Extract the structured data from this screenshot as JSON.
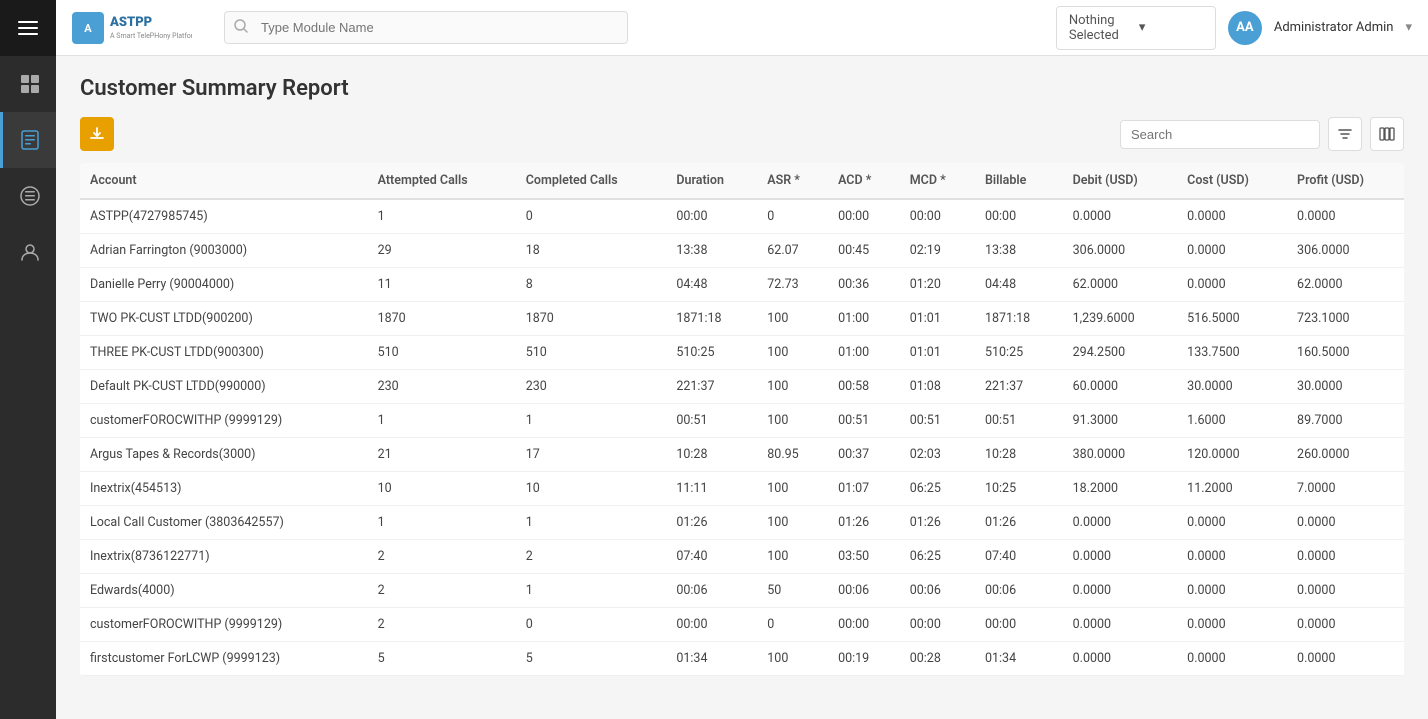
{
  "app": {
    "name": "ASTPP",
    "tagline": "A Smart TelePHony Platform"
  },
  "topbar": {
    "search_placeholder": "Type Module Name",
    "nothing_selected": "Nothing Selected",
    "user_initials": "AA",
    "user_name": "Administrator Admin"
  },
  "page": {
    "title": "Customer Summary Report"
  },
  "toolbar": {
    "search_placeholder": "Search"
  },
  "table": {
    "headers": [
      "Account",
      "Attempted Calls",
      "Completed Calls",
      "Duration",
      "ASR *",
      "ACD *",
      "MCD *",
      "Billable",
      "Debit (USD)",
      "Cost (USD)",
      "Profit (USD)"
    ],
    "rows": [
      [
        "ASTPP(4727985745)",
        "1",
        "0",
        "00:00",
        "0",
        "00:00",
        "00:00",
        "00:00",
        "0.0000",
        "0.0000",
        "0.0000"
      ],
      [
        "Adrian Farrington (9003000)",
        "29",
        "18",
        "13:38",
        "62.07",
        "00:45",
        "02:19",
        "13:38",
        "306.0000",
        "0.0000",
        "306.0000"
      ],
      [
        "Danielle Perry (90004000)",
        "11",
        "8",
        "04:48",
        "72.73",
        "00:36",
        "01:20",
        "04:48",
        "62.0000",
        "0.0000",
        "62.0000"
      ],
      [
        "TWO PK-CUST LTDD(900200)",
        "1870",
        "1870",
        "1871:18",
        "100",
        "01:00",
        "01:01",
        "1871:18",
        "1,239.6000",
        "516.5000",
        "723.1000"
      ],
      [
        "THREE PK-CUST LTDD(900300)",
        "510",
        "510",
        "510:25",
        "100",
        "01:00",
        "01:01",
        "510:25",
        "294.2500",
        "133.7500",
        "160.5000"
      ],
      [
        "Default PK-CUST LTDD(990000)",
        "230",
        "230",
        "221:37",
        "100",
        "00:58",
        "01:08",
        "221:37",
        "60.0000",
        "30.0000",
        "30.0000"
      ],
      [
        "customerFOROCWITHP (9999129)",
        "1",
        "1",
        "00:51",
        "100",
        "00:51",
        "00:51",
        "00:51",
        "91.3000",
        "1.6000",
        "89.7000"
      ],
      [
        "Argus Tapes & Records(3000)",
        "21",
        "17",
        "10:28",
        "80.95",
        "00:37",
        "02:03",
        "10:28",
        "380.0000",
        "120.0000",
        "260.0000"
      ],
      [
        "Inextrix(454513)",
        "10",
        "10",
        "11:11",
        "100",
        "01:07",
        "06:25",
        "10:25",
        "18.2000",
        "11.2000",
        "7.0000"
      ],
      [
        "Local Call Customer (3803642557)",
        "1",
        "1",
        "01:26",
        "100",
        "01:26",
        "01:26",
        "01:26",
        "0.0000",
        "0.0000",
        "0.0000"
      ],
      [
        "Inextrix(8736122771)",
        "2",
        "2",
        "07:40",
        "100",
        "03:50",
        "06:25",
        "07:40",
        "0.0000",
        "0.0000",
        "0.0000"
      ],
      [
        "Edwards(4000)",
        "2",
        "1",
        "00:06",
        "50",
        "00:06",
        "00:06",
        "00:06",
        "0.0000",
        "0.0000",
        "0.0000"
      ],
      [
        "customerFOROCWITHP (9999129)",
        "2",
        "0",
        "00:00",
        "0",
        "00:00",
        "00:00",
        "00:00",
        "0.0000",
        "0.0000",
        "0.0000"
      ],
      [
        "firstcustomer ForLCWP (9999123)",
        "5",
        "5",
        "01:34",
        "100",
        "00:19",
        "00:28",
        "01:34",
        "0.0000",
        "0.0000",
        "0.0000"
      ]
    ]
  },
  "sidebar": {
    "items": [
      {
        "name": "dashboard",
        "label": "Dashboard"
      },
      {
        "name": "reports",
        "label": "Reports"
      },
      {
        "name": "management",
        "label": "Management"
      },
      {
        "name": "accounts",
        "label": "Accounts"
      }
    ]
  }
}
